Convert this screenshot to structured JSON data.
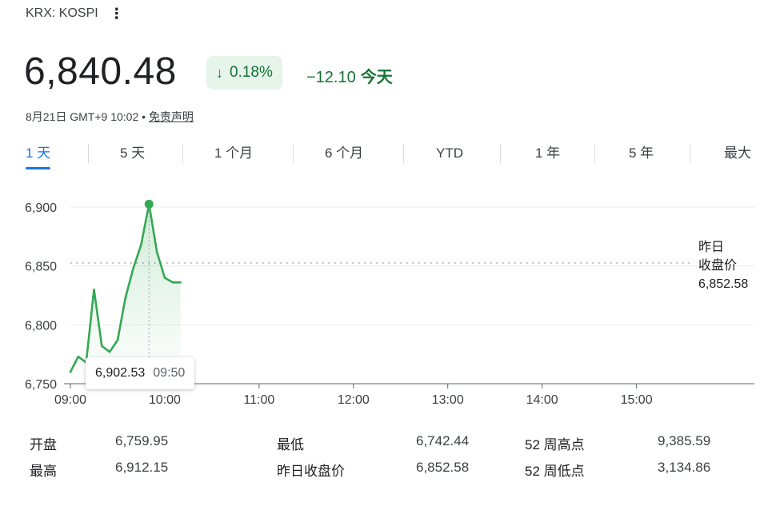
{
  "header": {
    "exchange": "KRX: KOSPI",
    "menu_glyph": "⋮",
    "price": "6,840.48",
    "change_percent": "0.18%",
    "change_arrow": "↓",
    "change_abs": "−12.10",
    "change_period": "今天",
    "timestamp": "8月21日 GMT+9 10:02",
    "bullet": "•",
    "disclaimer": "免责声明"
  },
  "tabs": [
    {
      "label": "1 天",
      "active": true
    },
    {
      "label": "5 天"
    },
    {
      "label": "1 个月"
    },
    {
      "label": "6 个月"
    },
    {
      "label": "YTD"
    },
    {
      "label": "1 年"
    },
    {
      "label": "5 年"
    },
    {
      "label": "最大"
    }
  ],
  "colors": {
    "up_down_green": "#34a853",
    "text_green": "#137333",
    "accent_blue": "#1a73e8",
    "grid": "#ebebeb"
  },
  "chart_data": {
    "type": "line",
    "y_ticks": [
      "6,900",
      "6,850",
      "6,800",
      "6,750"
    ],
    "y_tick_values": [
      6900,
      6850,
      6800,
      6750
    ],
    "x_ticks": [
      "09:00",
      "10:00",
      "11:00",
      "12:00",
      "13:00",
      "14:00",
      "15:00"
    ],
    "x_tick_minutes": [
      0,
      60,
      120,
      180,
      240,
      300,
      360
    ],
    "xlim_minutes": [
      0,
      435
    ],
    "ylim": [
      6750,
      6917
    ],
    "series": [
      {
        "x_minutes": [
          0,
          5,
          10,
          15,
          20,
          25,
          30,
          35,
          40,
          45,
          50,
          55,
          60,
          65,
          70
        ],
        "y": [
          6759.95,
          6773,
          6768,
          6830,
          6782,
          6777,
          6787,
          6823,
          6848,
          6868,
          6902.53,
          6862,
          6840,
          6836,
          6836
        ],
        "partial_x_minutes": [
          62,
          64
        ],
        "partial_y": [
          6838,
          6835
        ]
      }
    ],
    "previous_close_label": [
      "昨日",
      "收盘价"
    ],
    "previous_close_value": "6,852.58",
    "previous_close": 6852.58,
    "highlight": {
      "x_minutes": 50,
      "y": 6902.53,
      "price_text": "6,902.53",
      "time_text": "09:50"
    }
  },
  "stats": [
    {
      "label": "开盘",
      "value": "6,759.95"
    },
    {
      "label": "最高",
      "value": "6,912.15"
    },
    {
      "label": "最低",
      "value": "6,742.44"
    },
    {
      "label": "昨日收盘价",
      "value": "6,852.58"
    },
    {
      "label": "52 周高点",
      "value": "9,385.59"
    },
    {
      "label": "52 周低点",
      "value": "3,134.86"
    }
  ]
}
